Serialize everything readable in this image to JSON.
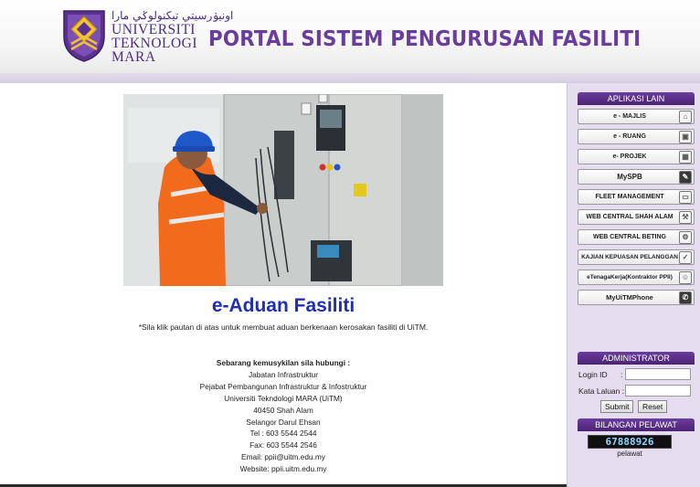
{
  "header": {
    "logo_jawi": "اونيۏرسيتي تيکنولوݢي مارا",
    "logo_lines": [
      "UNIVERSITI",
      "TEKNOLOGI",
      "MARA"
    ],
    "title": "PORTAL SISTEM PENGURUSAN FASILITI"
  },
  "main": {
    "heading": "e-Aduan Fasiliti",
    "note": "*Sila klik pautan di atas untuk membuat aduan berkenaan kerosakan fasiliti di UiTM.",
    "contact_title": "Sebarang kemusykilan sila hubungi :",
    "contact_lines": [
      "Jabatan Infrastruktur",
      "Pejabat Pembangunan Infrastruktur & Infostruktur",
      "Universiti Tekndologi MARA (UiTM)",
      "40450 Shah Alam",
      "Selangor Darul Ehsan",
      "Tel : 603 5544 2544",
      "Fax: 603 5544 2546",
      "Email: ppii@uitm.edu.my",
      "Website: ppii.uitm.edu.my"
    ]
  },
  "sidebar": {
    "apps_title": "APLIKASI LAIN",
    "apps": [
      {
        "label": "e - MAJLIS",
        "icon": "building-icon"
      },
      {
        "label": "e - RUANG",
        "icon": "room-icon"
      },
      {
        "label": "e- PROJEK",
        "icon": "project-icon"
      },
      {
        "label": "MySPB",
        "icon": "edit-icon"
      },
      {
        "label": "FLEET MANAGEMENT",
        "icon": "car-icon"
      },
      {
        "label": "WEB CENTRAL SHAH ALAM",
        "icon": "wrench-icon"
      },
      {
        "label": "WEB CENTRAL BETING",
        "icon": "tools-icon"
      },
      {
        "label": "KAJIAN KEPUASAN PELANGGAN",
        "icon": "check-icon"
      },
      {
        "label": "eTenagaKerja(Kontraktor PPII)",
        "icon": "worker-icon"
      },
      {
        "label": "MyUiTMPhone",
        "icon": "phone-icon"
      }
    ],
    "admin_title": "ADMINISTRATOR",
    "login_id_label": "Login ID",
    "login_id_colon": ":",
    "password_label": "Kata Laluan :",
    "submit_label": "Submit",
    "reset_label": "Reset",
    "visitor_title": "BILANGAN PELAWAT",
    "visitor_count": "67888926",
    "visitor_suffix": "pelawat"
  },
  "colors": {
    "brand_purple": "#6a3d9c",
    "heading_blue": "#1f2fb0",
    "sidebar_bg": "#e6dcef"
  }
}
